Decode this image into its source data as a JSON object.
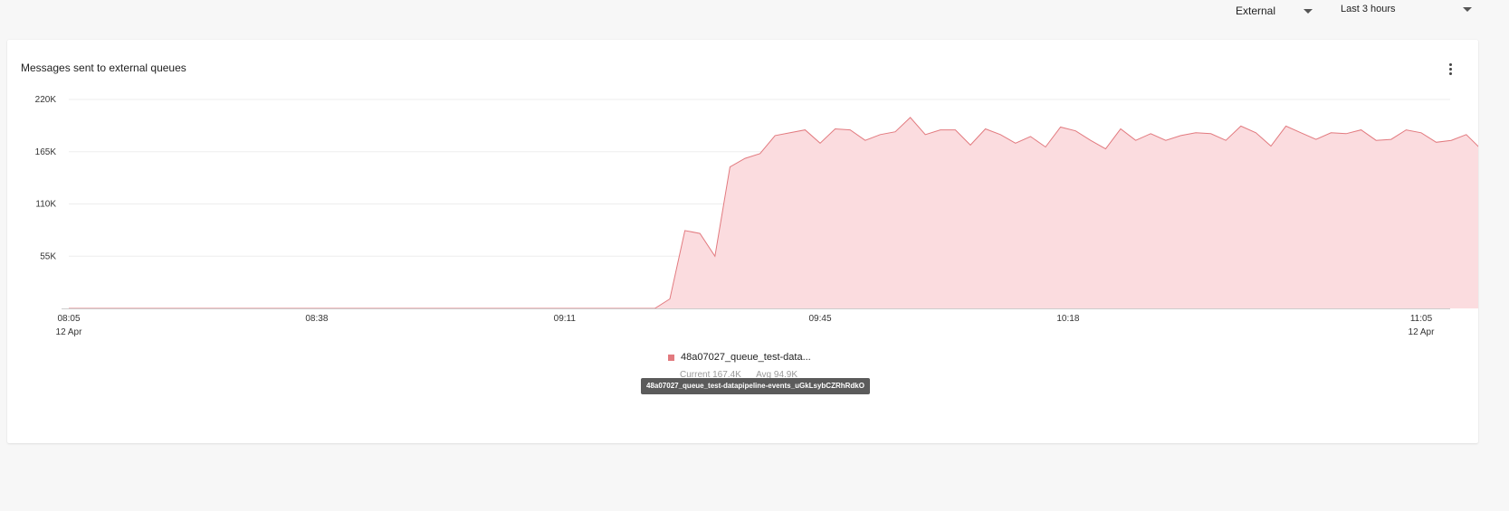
{
  "filters": {
    "source": "External",
    "time_range": "Last 3 hours"
  },
  "panel": {
    "title": "Messages sent to external queues"
  },
  "colors": {
    "series_line": "#e27a7f",
    "series_fill": "#fbdcdf",
    "grid": "#eeeeee",
    "axis": "#cccccc"
  },
  "legend": {
    "name": "48a07027_queue_test-data...",
    "current": "Current 167.4K",
    "avg": "Avg 94.9K",
    "tooltip": "48a07027_queue_test-datapipeline-events_uGkLsybCZRhRdkO"
  },
  "chart_data": {
    "type": "area",
    "title": "Messages sent to external queues",
    "xlabel": "",
    "ylabel": "",
    "x_time_range": [
      "08:05",
      "11:05"
    ],
    "x_tick_labels": [
      {
        "time": "08:05",
        "date": "12 Apr"
      },
      {
        "time": "08:38",
        "date": ""
      },
      {
        "time": "09:11",
        "date": ""
      },
      {
        "time": "09:45",
        "date": ""
      },
      {
        "time": "10:18",
        "date": ""
      },
      {
        "time": "11:05",
        "date": "12 Apr"
      }
    ],
    "y_ticks": [
      {
        "value": 55000,
        "label": "55K"
      },
      {
        "value": 110000,
        "label": "110K"
      },
      {
        "value": 165000,
        "label": "165K"
      },
      {
        "value": 220000,
        "label": "220K"
      }
    ],
    "ylim": [
      0,
      220000
    ],
    "grid": true,
    "series": [
      {
        "name": "48a07027_queue_test-datapipeline-events_uGkLsybCZRhRdkO",
        "points": [
          [
            "08:05",
            0
          ],
          [
            "08:38",
            0
          ],
          [
            "09:11",
            0
          ],
          [
            "09:23",
            0
          ],
          [
            "09:25",
            10000
          ],
          [
            "09:27",
            82000
          ],
          [
            "09:29",
            79000
          ],
          [
            "09:31",
            55000
          ],
          [
            "09:33",
            149000
          ],
          [
            "09:35",
            158000
          ],
          [
            "09:37",
            163000
          ],
          [
            "09:39",
            182000
          ],
          [
            "09:41",
            185000
          ],
          [
            "09:43",
            188000
          ],
          [
            "09:45",
            174000
          ],
          [
            "09:47",
            189000
          ],
          [
            "09:49",
            188000
          ],
          [
            "09:51",
            177000
          ],
          [
            "09:53",
            183000
          ],
          [
            "09:55",
            186000
          ],
          [
            "09:57",
            201000
          ],
          [
            "09:59",
            183000
          ],
          [
            "10:01",
            188000
          ],
          [
            "10:03",
            188000
          ],
          [
            "10:05",
            172000
          ],
          [
            "10:07",
            189000
          ],
          [
            "10:09",
            183000
          ],
          [
            "10:11",
            174000
          ],
          [
            "10:13",
            181000
          ],
          [
            "10:15",
            170000
          ],
          [
            "10:17",
            191000
          ],
          [
            "10:19",
            187000
          ],
          [
            "10:21",
            177000
          ],
          [
            "10:23",
            168000
          ],
          [
            "10:25",
            189000
          ],
          [
            "10:27",
            177000
          ],
          [
            "10:29",
            184000
          ],
          [
            "10:31",
            177000
          ],
          [
            "10:33",
            182000
          ],
          [
            "10:35",
            185000
          ],
          [
            "10:37",
            184000
          ],
          [
            "10:39",
            177000
          ],
          [
            "10:41",
            192000
          ],
          [
            "10:43",
            185000
          ],
          [
            "10:45",
            171000
          ],
          [
            "10:47",
            192000
          ],
          [
            "10:49",
            185000
          ],
          [
            "10:51",
            178000
          ],
          [
            "10:53",
            185000
          ],
          [
            "10:55",
            184000
          ],
          [
            "10:57",
            188000
          ],
          [
            "10:59",
            177000
          ],
          [
            "11:01",
            178000
          ],
          [
            "11:03",
            188000
          ],
          [
            "11:05",
            185000
          ],
          [
            "11:07",
            175000
          ],
          [
            "11:09",
            177000
          ],
          [
            "11:11",
            183000
          ],
          [
            "11:13",
            167400
          ]
        ]
      }
    ]
  }
}
